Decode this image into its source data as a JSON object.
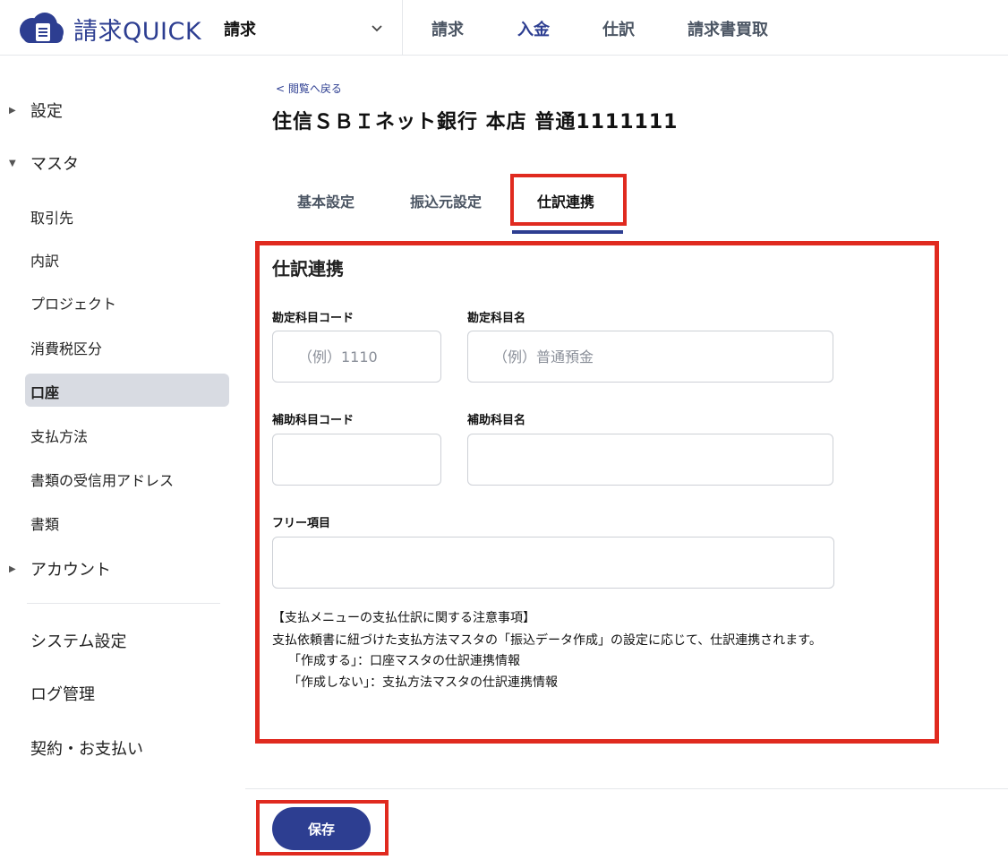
{
  "header": {
    "app_name": "請求QUICK",
    "module": "請求",
    "nav": [
      "請求",
      "入金",
      "仕訳",
      "請求書買取"
    ],
    "active_nav": "入金",
    "brand_color": "#2d3e91"
  },
  "sidebar": {
    "settings": "設定",
    "master": "マスタ",
    "master_items": [
      "取引先",
      "内訳",
      "プロジェクト",
      "消費税区分",
      "口座",
      "支払方法",
      "書類の受信用アドレス",
      "書類"
    ],
    "active_item": "口座",
    "account": "アカウント",
    "system_settings": "システム設定",
    "log_management": "ログ管理",
    "contract": "契約・お支払い"
  },
  "main": {
    "back_link": "< 閲覧へ戻る",
    "title": "住信ＳＢＩネット銀行 本店 普通1111111",
    "tabs": [
      "基本設定",
      "振込元設定",
      "仕訳連携"
    ],
    "active_tab": "仕訳連携",
    "panel_title": "仕訳連携",
    "fields": {
      "account_code_label": "勘定科目コード",
      "account_code_placeholder": "（例）1110",
      "account_name_label": "勘定科目名",
      "account_name_placeholder": "（例）普通預金",
      "sub_code_label": "補助科目コード",
      "sub_name_label": "補助科目名",
      "free_label": "フリー項目"
    },
    "note": {
      "heading": "【支払メニューの支払仕訳に関する注意事項】",
      "line1": "支払依頼書に紐づけた支払方法マスタの「振込データ作成」の設定に応じて、仕訳連携されます。",
      "line2": "「作成する」：口座マスタの仕訳連携情報",
      "line3": "「作成しない」：支払方法マスタの仕訳連携情報"
    },
    "save_label": "保存",
    "highlight_color": "#e02a1f"
  }
}
